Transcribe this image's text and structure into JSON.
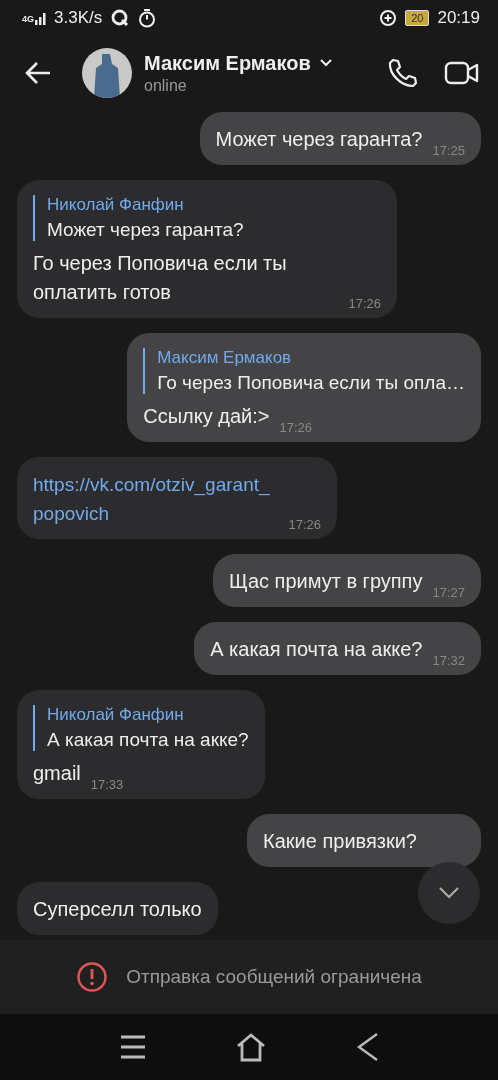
{
  "status_bar": {
    "network": "4G",
    "speed": "3.3K/s",
    "battery": "20",
    "time": "20:19"
  },
  "header": {
    "name": "Максим Ермаков",
    "status": "online"
  },
  "messages": [
    {
      "kind": "outgoing",
      "text": "Может через гаранта?",
      "time": "17:25"
    },
    {
      "kind": "incoming",
      "reply": {
        "author": "Николай Фанфин",
        "text": "Может через гаранта?"
      },
      "text": "Го через Поповича если ты оплатить готов",
      "time": "17:26"
    },
    {
      "kind": "outgoing",
      "reply": {
        "author": "Максим Ермаков",
        "text": "Го через Поповича если ты опла…"
      },
      "text": "Ссылку дай:>",
      "time": "17:26"
    },
    {
      "kind": "incoming",
      "link": true,
      "text": "https://vk.com/otziv_garant_popovich",
      "time": "17:26"
    },
    {
      "kind": "outgoing",
      "text": "Щас примут в группу",
      "time": "17:27"
    },
    {
      "kind": "outgoing",
      "text": "А какая почта на акке?",
      "time": "17:32"
    },
    {
      "kind": "incoming",
      "reply": {
        "author": "Николай Фанфин",
        "text": "А какая почта на акке?"
      },
      "text": "gmail",
      "time": "17:33"
    },
    {
      "kind": "outgoing",
      "text": "Какие привязки?"
    },
    {
      "kind": "incoming",
      "text": "Суперселл только"
    }
  ],
  "notice": "Отправка сообщений ограничена"
}
